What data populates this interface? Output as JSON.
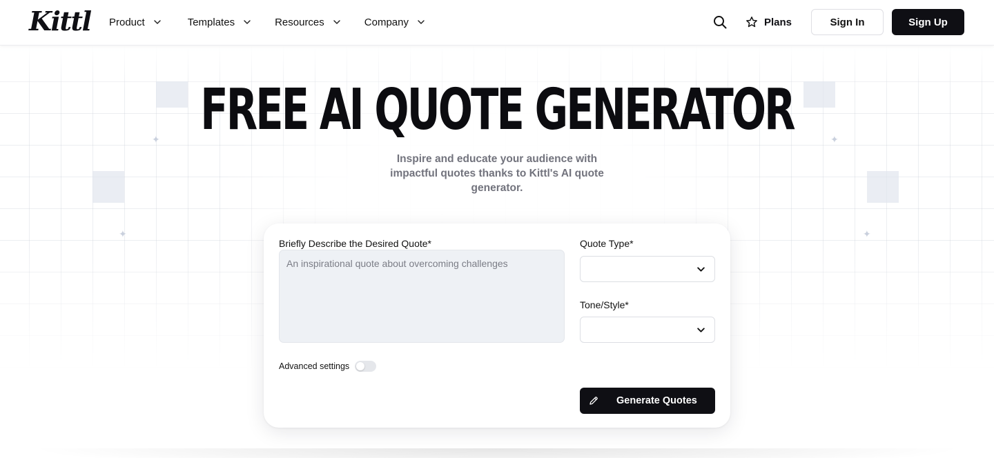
{
  "brand": {
    "logo_text": "Kittl"
  },
  "nav": {
    "items": [
      {
        "label": "Product"
      },
      {
        "label": "Templates"
      },
      {
        "label": "Resources"
      },
      {
        "label": "Company"
      }
    ]
  },
  "header_actions": {
    "search_icon": "search-icon",
    "plans_label": "Plans",
    "signin_label": "Sign In",
    "signup_label": "Sign Up"
  },
  "hero": {
    "title": "FREE AI QUOTE GENERATOR",
    "subtitle": "Inspire and educate your audience with impactful quotes thanks to Kittl's AI quote generator."
  },
  "form": {
    "description_label": "Briefly Describe the Desired Quote*",
    "description_placeholder": "An inspirational quote about overcoming challenges",
    "quote_type_label": "Quote Type*",
    "quote_type_value": "",
    "tone_label": "Tone/Style*",
    "tone_value": "",
    "advanced_label": "Advanced settings",
    "advanced_enabled": false,
    "generate_label": "Generate Quotes"
  },
  "colors": {
    "primary": "#0f0f14",
    "textarea_bg": "#eef1f5",
    "subtitle": "#72737d"
  }
}
